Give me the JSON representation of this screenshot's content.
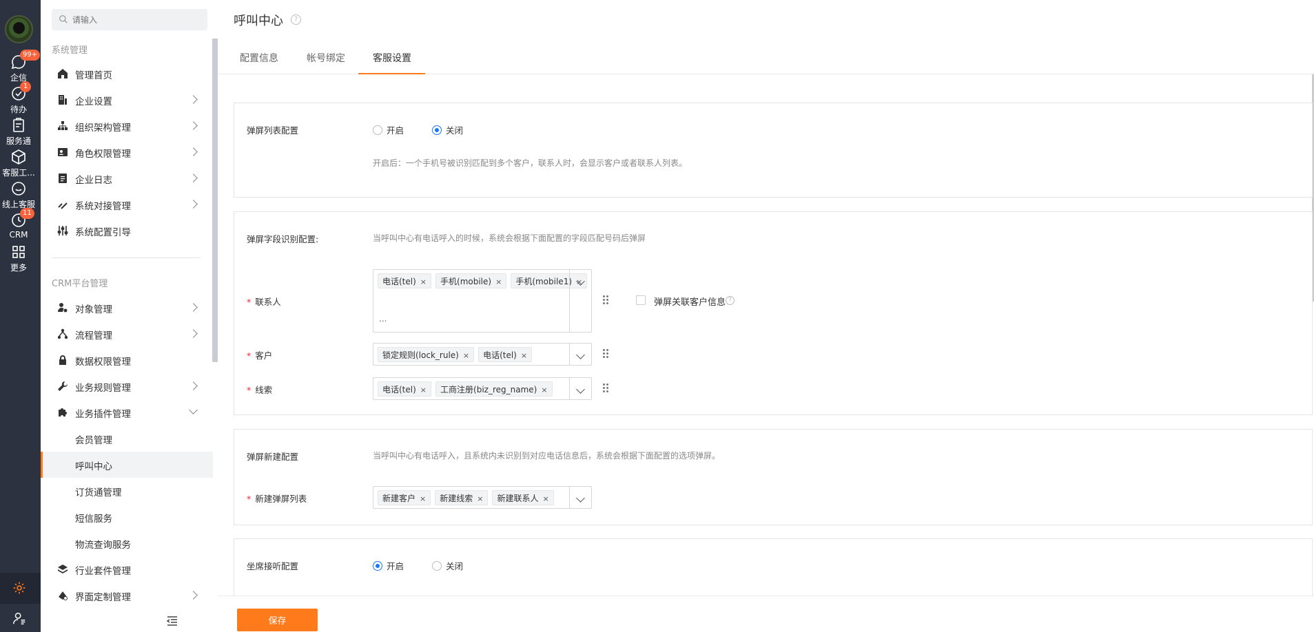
{
  "rail": {
    "items": [
      {
        "label": "企信",
        "icon": "chat-icon",
        "badge": "99+"
      },
      {
        "label": "待办",
        "icon": "check-circle-icon",
        "badge": "1"
      },
      {
        "label": "服务通",
        "icon": "clipboard-icon",
        "badge": ""
      },
      {
        "label": "客服工...",
        "icon": "cube-icon",
        "badge": ""
      },
      {
        "label": "线上客服",
        "icon": "smile-icon",
        "badge": ""
      },
      {
        "label": "CRM",
        "icon": "clock-icon",
        "badge": "11"
      },
      {
        "label": "更多",
        "icon": "grid-icon",
        "badge": ""
      }
    ],
    "bottom_icons": [
      "gear-icon",
      "user-settings-icon"
    ]
  },
  "sidebar": {
    "search_placeholder": "请输入",
    "group1_title": "系统管理",
    "group2_title": "CRM平台管理",
    "items1": [
      {
        "label": "管理首页",
        "icon": "home-icon",
        "chevron": false
      },
      {
        "label": "企业设置",
        "icon": "building-icon",
        "chevron": true
      },
      {
        "label": "组织架构管理",
        "icon": "org-chart-icon",
        "chevron": true
      },
      {
        "label": "角色权限管理",
        "icon": "id-card-icon",
        "chevron": true
      },
      {
        "label": "企业日志",
        "icon": "document-icon",
        "chevron": true
      },
      {
        "label": "系统对接管理",
        "icon": "link-icon",
        "chevron": true
      },
      {
        "label": "系统配置引导",
        "icon": "sliders-icon",
        "chevron": false
      }
    ],
    "items2": [
      {
        "label": "对象管理",
        "icon": "person-gear-icon",
        "chevron": true
      },
      {
        "label": "流程管理",
        "icon": "flow-icon",
        "chevron": true
      },
      {
        "label": "数据权限管理",
        "icon": "lock-icon",
        "chevron": false
      },
      {
        "label": "业务规则管理",
        "icon": "wrench-icon",
        "chevron": true
      },
      {
        "label": "业务插件管理",
        "icon": "puzzle-icon",
        "chevron": "down"
      }
    ],
    "sub_items": [
      "会员管理",
      "呼叫中心",
      "订货通管理",
      "短信服务",
      "物流查询服务"
    ],
    "active_sub": "呼叫中心",
    "items3": [
      {
        "label": "行业套件管理",
        "icon": "layers-icon",
        "chevron": false
      },
      {
        "label": "界面定制管理",
        "icon": "paint-icon",
        "chevron": true
      }
    ]
  },
  "main": {
    "title": "呼叫中心",
    "tabs": [
      "配置信息",
      "帐号绑定",
      "客服设置"
    ],
    "active_tab": "客服设置",
    "section1": {
      "label": "弹屏列表配置",
      "options": [
        "开启",
        "关闭"
      ],
      "selected": "关闭",
      "description": "开启后：一个手机号被识别匹配到多个客户，联系人时，会显示客户或者联系人列表。"
    },
    "section2": {
      "label": "弹屏字段识别配置:",
      "description": "当呼叫中心有电话呼入的时候，系统会根据下面配置的字段匹配号码后弹屏",
      "rows": [
        {
          "label": "联系人",
          "tags": [
            "电话(tel)",
            "手机(mobile)",
            "手机(mobile1)"
          ],
          "overflow": "..."
        },
        {
          "label": "客户",
          "tags": [
            "锁定规则(lock_rule)",
            "电话(tel)"
          ]
        },
        {
          "label": "线索",
          "tags": [
            "电话(tel)",
            "工商注册(biz_reg_name)"
          ]
        }
      ],
      "checkbox_label": "弹屏关联客户信息"
    },
    "section3": {
      "label": "弹屏新建配置",
      "description": "当呼叫中心有电话呼入，且系统内未识别到对应电话信息后，系统会根据下面配置的选项弹屏。",
      "row_label": "新建弹屏列表",
      "tags": [
        "新建客户",
        "新建线索",
        "新建联系人"
      ]
    },
    "section4": {
      "label": "坐席接听配置",
      "options": [
        "开启",
        "关闭"
      ],
      "selected": "开启"
    },
    "save_label": "保存",
    "tag_close": "×",
    "help_glyph": "?"
  },
  "colors": {
    "accent": "#ff7a1a",
    "rail_bg": "#2c3240",
    "radio_on": "#1677ff",
    "badge": "#f5623b"
  }
}
